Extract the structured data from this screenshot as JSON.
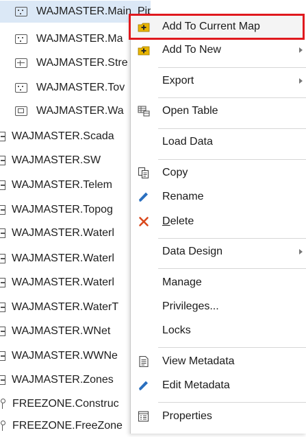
{
  "tree": {
    "items": [
      {
        "label": "WAJMASTER.Main_Pipe",
        "icon": "feature-class-icon",
        "selected": true
      },
      {
        "label": "WAJMASTER.Ma",
        "icon": "feature-class-icon"
      },
      {
        "label": "WAJMASTER.Stre",
        "icon": "line-feature-icon"
      },
      {
        "label": "WAJMASTER.Tov",
        "icon": "feature-class-icon"
      },
      {
        "label": "WAJMASTER.Wa",
        "icon": "raster-icon"
      },
      {
        "label": "WAJMASTER.Scada",
        "icon": "table-icon"
      },
      {
        "label": "WAJMASTER.SW",
        "icon": "table-icon"
      },
      {
        "label": "WAJMASTER.Telem",
        "icon": "table-icon"
      },
      {
        "label": "WAJMASTER.Topog",
        "icon": "table-icon"
      },
      {
        "label": "WAJMASTER.Waterl",
        "icon": "table-icon"
      },
      {
        "label": "WAJMASTER.Waterl",
        "icon": "table-icon"
      },
      {
        "label": "WAJMASTER.Waterl",
        "icon": "table-icon"
      },
      {
        "label": "WAJMASTER.WaterT",
        "icon": "table-icon"
      },
      {
        "label": "WAJMASTER.WNet",
        "icon": "table-icon"
      },
      {
        "label": "WAJMASTER.WWNe",
        "icon": "table-icon"
      },
      {
        "label": "WAJMASTER.Zones",
        "icon": "table-icon"
      },
      {
        "label": "FREEZONE.Construc",
        "icon": "dataset-icon"
      },
      {
        "label": "FREEZONE.FreeZone",
        "icon": "dataset-icon"
      }
    ]
  },
  "menu": {
    "add_current": "Add To Current Map",
    "add_new": "Add To New",
    "export": "Export",
    "open_table": "Open Table",
    "load_data": "Load Data",
    "copy": "Copy",
    "rename": "Rename",
    "delete_first": "D",
    "delete_rest": "elete",
    "data_design": "Data Design",
    "manage": "Manage",
    "privileges": "Privileges...",
    "locks": "Locks",
    "view_metadata": "View Metadata",
    "edit_metadata": "Edit Metadata",
    "properties": "Properties"
  },
  "colors": {
    "highlight_border": "#e0191e",
    "selection": "#dbe8f6",
    "delete_x": "#d9481c",
    "pencil": "#2a6fbf",
    "add_icon": "#e8b500"
  }
}
